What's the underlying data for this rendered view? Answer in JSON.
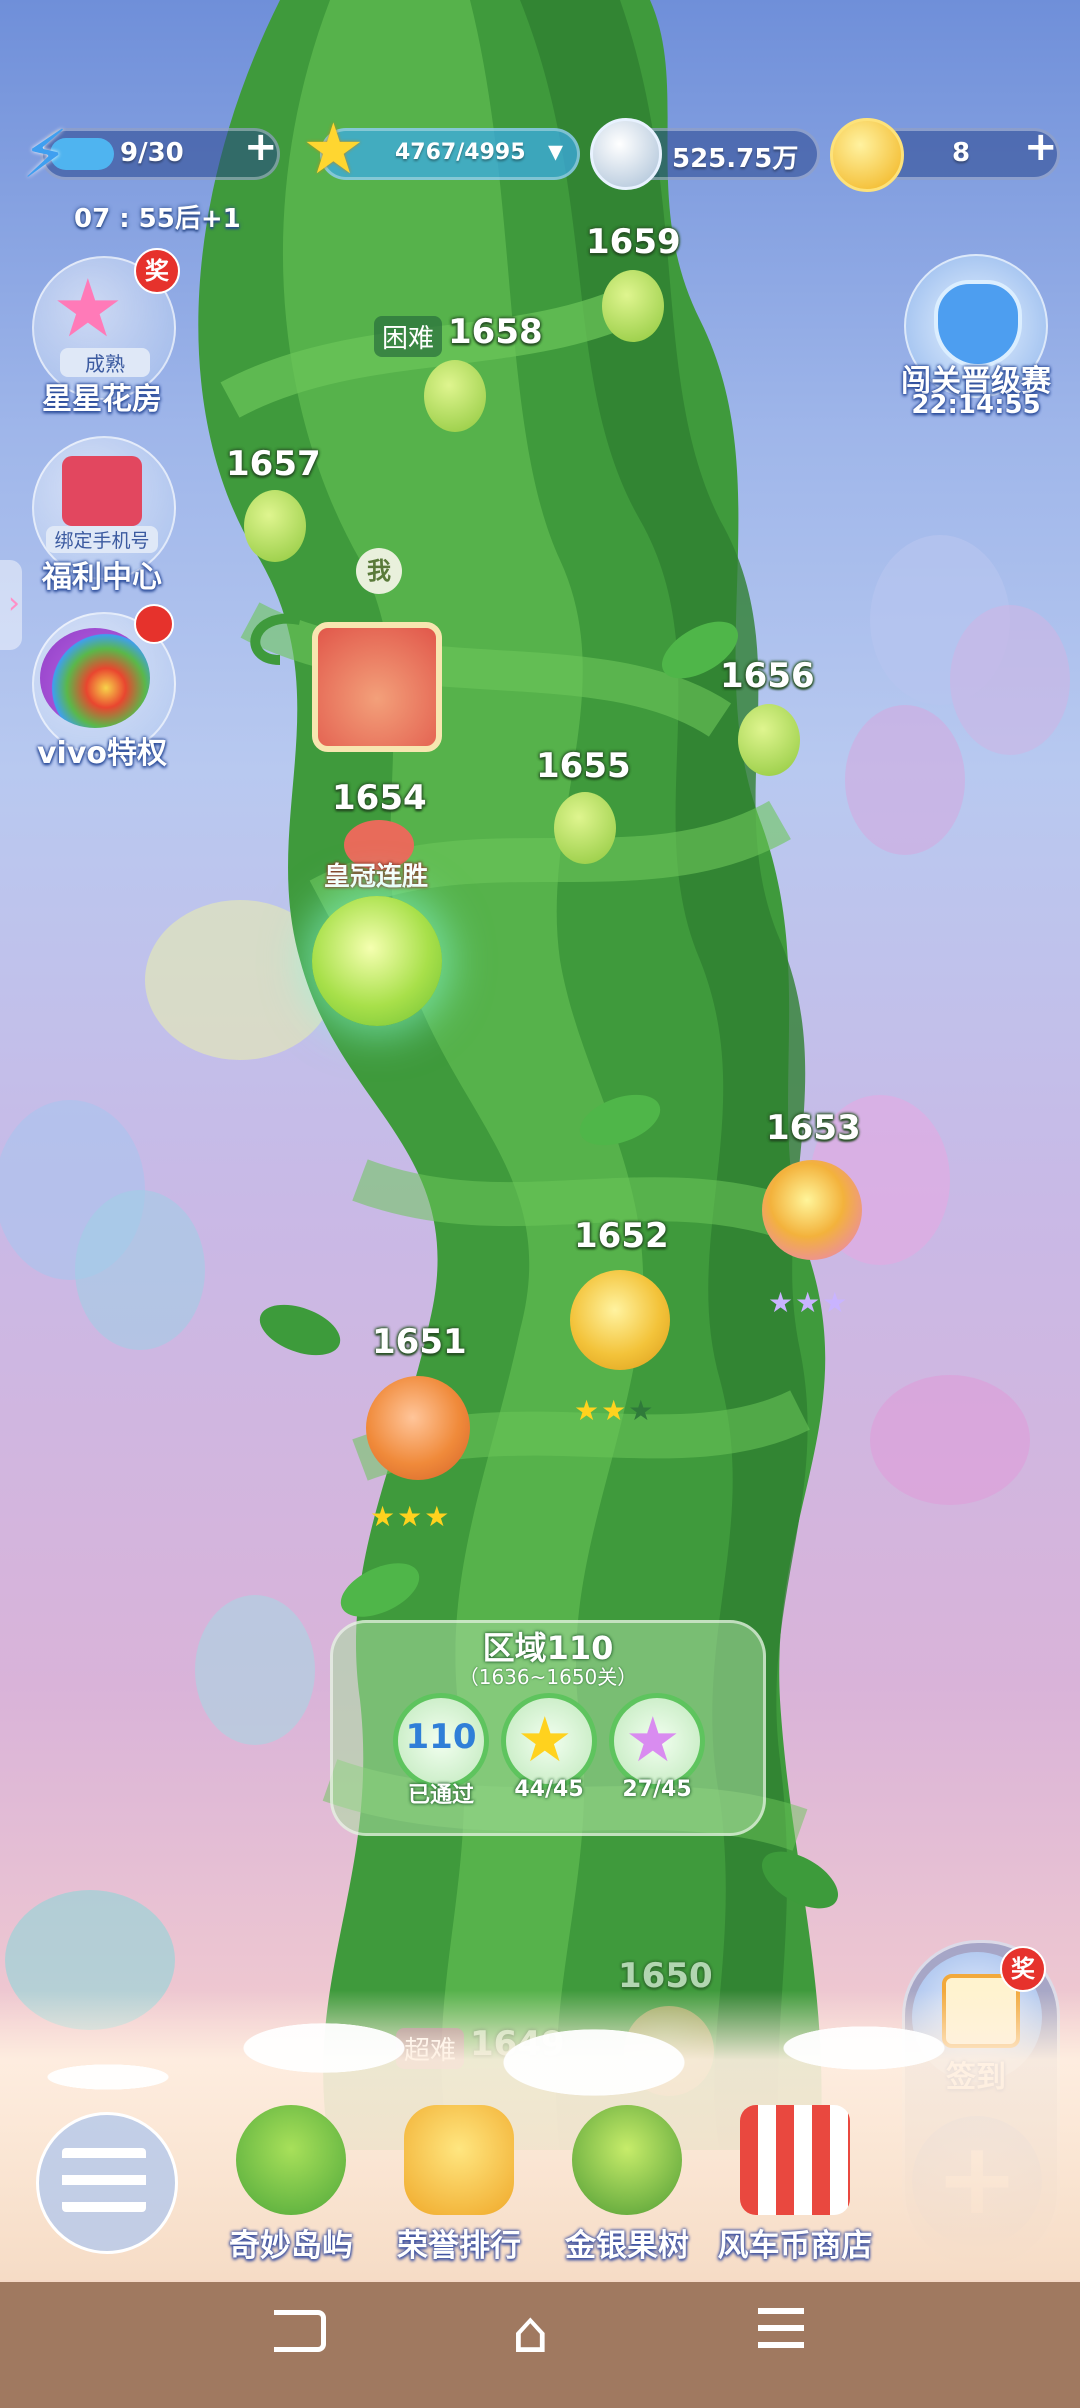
{
  "top_bar": {
    "energy": "9/30",
    "energy_add": "+",
    "stars": "4767/4995",
    "stars_dropdown": "▾",
    "silver": "525.75万",
    "coins": "8",
    "coins_add": "+",
    "timer": "07 : 55后+1"
  },
  "left_menu": {
    "flower_house_badge": "奖",
    "flower_house_tag": "成熟",
    "flower_house": "星星花房",
    "welfare_tag": "绑定手机号",
    "welfare": "福利中心",
    "vivo": "vivo特权"
  },
  "right_menu": {
    "tournament": "闯关晋级赛",
    "tournament_timer": "22:14:55",
    "checkin_badge": "奖",
    "checkin": "签到",
    "add": "+"
  },
  "map": {
    "me_label": "我",
    "crown_streak": "皇冠连胜",
    "hard_tag": "困难",
    "super_hard_tag": "超难",
    "levels": {
      "l1649": "1649",
      "l1650": "1650",
      "l1651": "1651",
      "l1652": "1652",
      "l1653": "1653",
      "l1654": "1654",
      "l1655": "1655",
      "l1656": "1656",
      "l1657": "1657",
      "l1658": "1658",
      "l1659": "1659"
    },
    "level_stars": {
      "l1651": 3,
      "l1652": 2,
      "l1653": 3
    }
  },
  "region": {
    "title": "区域110",
    "range": "（1636~1650关）",
    "number": "110",
    "passed": "已通过",
    "gold_stars": "44/45",
    "rainbow_stars": "27/45"
  },
  "bottom_nav": {
    "island": "奇妙岛屿",
    "ranking": "荣誉排行",
    "fruit_tree": "金银果树",
    "shop": "风车币商店"
  },
  "colors": {
    "stalk": "#3f9a3c",
    "pod_green": "#9bd24a",
    "pod_orange": "#f08a3a",
    "pod_gold": "#f3c33a",
    "system_bar": "#a07960"
  }
}
